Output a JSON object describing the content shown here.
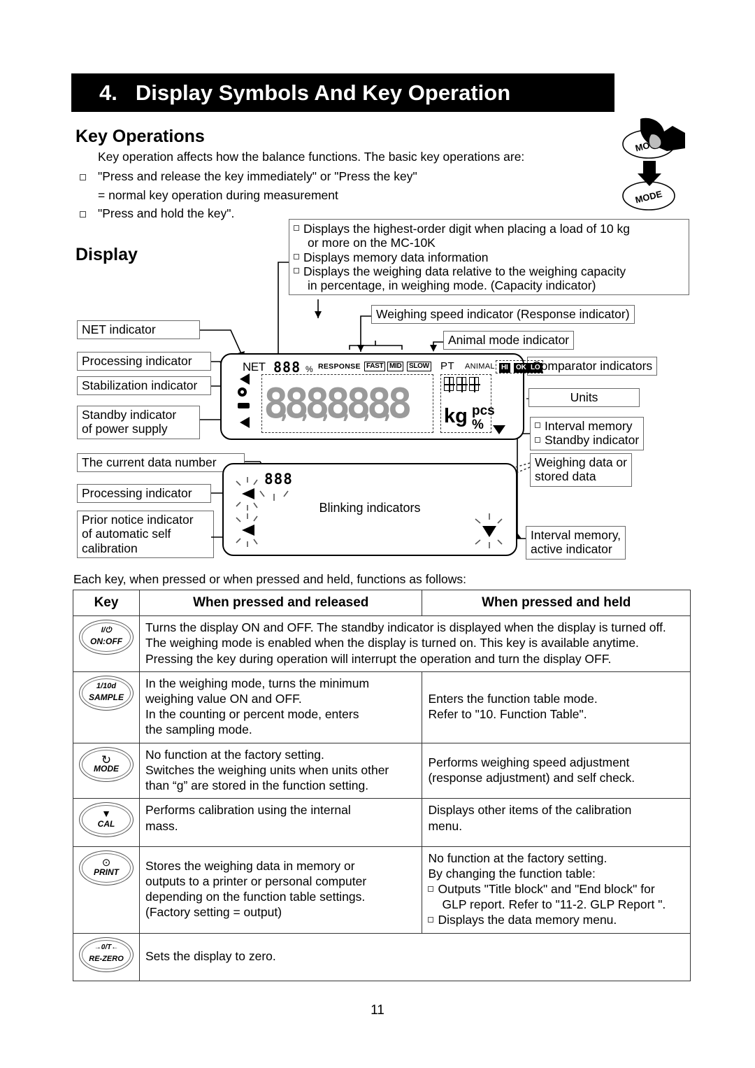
{
  "chapter": {
    "number": "4.",
    "title": "Display Symbols And Key Operation"
  },
  "sections": {
    "key_operations_heading": "Key Operations",
    "key_operations_intro": "Key operation affects how the balance functions. The basic key operations are:",
    "bullet1": "\"Press and release the key immediately\" or \"Press the key\"",
    "bullet1_cont": "= normal key operation during measurement",
    "bullet2": "\"Press and hold the key\".",
    "display_heading": "Display"
  },
  "mode_graphic": {
    "label_top": "MODE",
    "label_bottom": "MODE"
  },
  "callouts": {
    "top_box": {
      "line1": "Displays the highest-order digit when placing a load of 10 kg",
      "line1_cont": "or more on the MC-10K",
      "line2": "Displays memory data information",
      "line3": "Displays the weighing data relative to the weighing capacity",
      "line3_cont": "in percentage, in weighing mode. (Capacity indicator)"
    },
    "weighing_speed": "Weighing speed indicator (Response indicator)",
    "animal_mode": "Animal mode indicator",
    "comparator": "Comparator indicators",
    "units": "Units",
    "interval_memory": "Interval memory",
    "standby_indicator": "Standby indicator",
    "weighing_data_l1": "Weighing data or",
    "weighing_data_l2": "stored data",
    "interval_active_l1": "Interval memory,",
    "interval_active_l2": "active indicator",
    "net": "NET indicator",
    "processing1": "Processing indicator",
    "stabilization": "Stabilization indicator",
    "standby_power_l1": "Standby indicator",
    "standby_power_l2": "of power supply",
    "data_number": "The current data number",
    "processing2": "Processing indicator",
    "prior_notice_l1": "Prior notice indicator",
    "prior_notice_l2": "of automatic self",
    "prior_notice_l3": "calibration",
    "blinking": "Blinking indicators"
  },
  "lcd": {
    "net": "NET",
    "small_digits": "888",
    "percent": "%",
    "response": "RESPONSE",
    "fast": "FAST",
    "mid": "MID",
    "slow": "SLOW",
    "pt": "PT",
    "animal": "ANIMAL",
    "hi": "HI",
    "ok": "OK",
    "lo": "LO",
    "kg": "kg",
    "pcs": "pcs",
    "percent_unit": "%",
    "main_digits": "8.8.8.8.8.8.8"
  },
  "blink_panel": {
    "small_digits": "888"
  },
  "table_intro": "Each key, when pressed or when pressed and held, functions as follows:",
  "table": {
    "headers": {
      "key": "Key",
      "pressed_released": "When pressed and released",
      "pressed_held": "When pressed and held"
    },
    "rows": [
      {
        "key_line1": "I/⏻",
        "key_line2": "ON:OFF",
        "pressed_released": "Turns the display ON and OFF. The standby indicator is displayed when the display is turned off. The weighing mode is enabled when the display is turned on. This key is available anytime. Pressing the key during operation will interrupt the operation and turn the display OFF.",
        "pressed_held": "",
        "span": true
      },
      {
        "key_line1": "1/10d",
        "key_line2": "SAMPLE",
        "pressed_released_l1": "In the weighing mode, turns the minimum",
        "pressed_released_l2": "weighing value ON and OFF.",
        "pressed_released_l3": "In the counting or percent mode, enters",
        "pressed_released_l4": "the sampling mode.",
        "pressed_held_l1": "Enters the function table mode.",
        "pressed_held_l2": "Refer to \"10. Function Table\"."
      },
      {
        "key_line1": "↻",
        "key_line2": "MODE",
        "pressed_released_l1": "No function at the factory setting.",
        "pressed_released_l2": "Switches the weighing units when units other",
        "pressed_released_l3": "than “g” are stored in the function setting.",
        "pressed_held_l1": "Performs weighing speed adjustment",
        "pressed_held_l2": "(response adjustment) and self check."
      },
      {
        "key_line1": "▼",
        "key_line2": "CAL",
        "pressed_released_l1": "Performs calibration using the internal",
        "pressed_released_l2": "mass.",
        "pressed_held_l1": "Displays other items of the calibration",
        "pressed_held_l2": "menu."
      },
      {
        "key_line1": "⊙",
        "key_line2": "PRINT",
        "pressed_released_l1": "Stores the weighing data in memory or",
        "pressed_released_l2": "outputs to a printer or personal computer",
        "pressed_released_l3": "depending on the function table settings.",
        "pressed_released_l4": "(Factory setting = output)",
        "pressed_held_l1": "No function at the factory setting.",
        "pressed_held_l2": "By changing the function table:",
        "pressed_held_b1": "Outputs \"Title block\" and \"End block\" for",
        "pressed_held_b1_cont": "GLP report. Refer to \"11-2. GLP Report \".",
        "pressed_held_b2": "Displays the data memory menu."
      },
      {
        "key_line1": "→0/T←",
        "key_line2": "RE-ZERO",
        "pressed_released": "Sets the display to zero.",
        "pressed_held": "",
        "span": true
      }
    ]
  },
  "page_number": "11"
}
